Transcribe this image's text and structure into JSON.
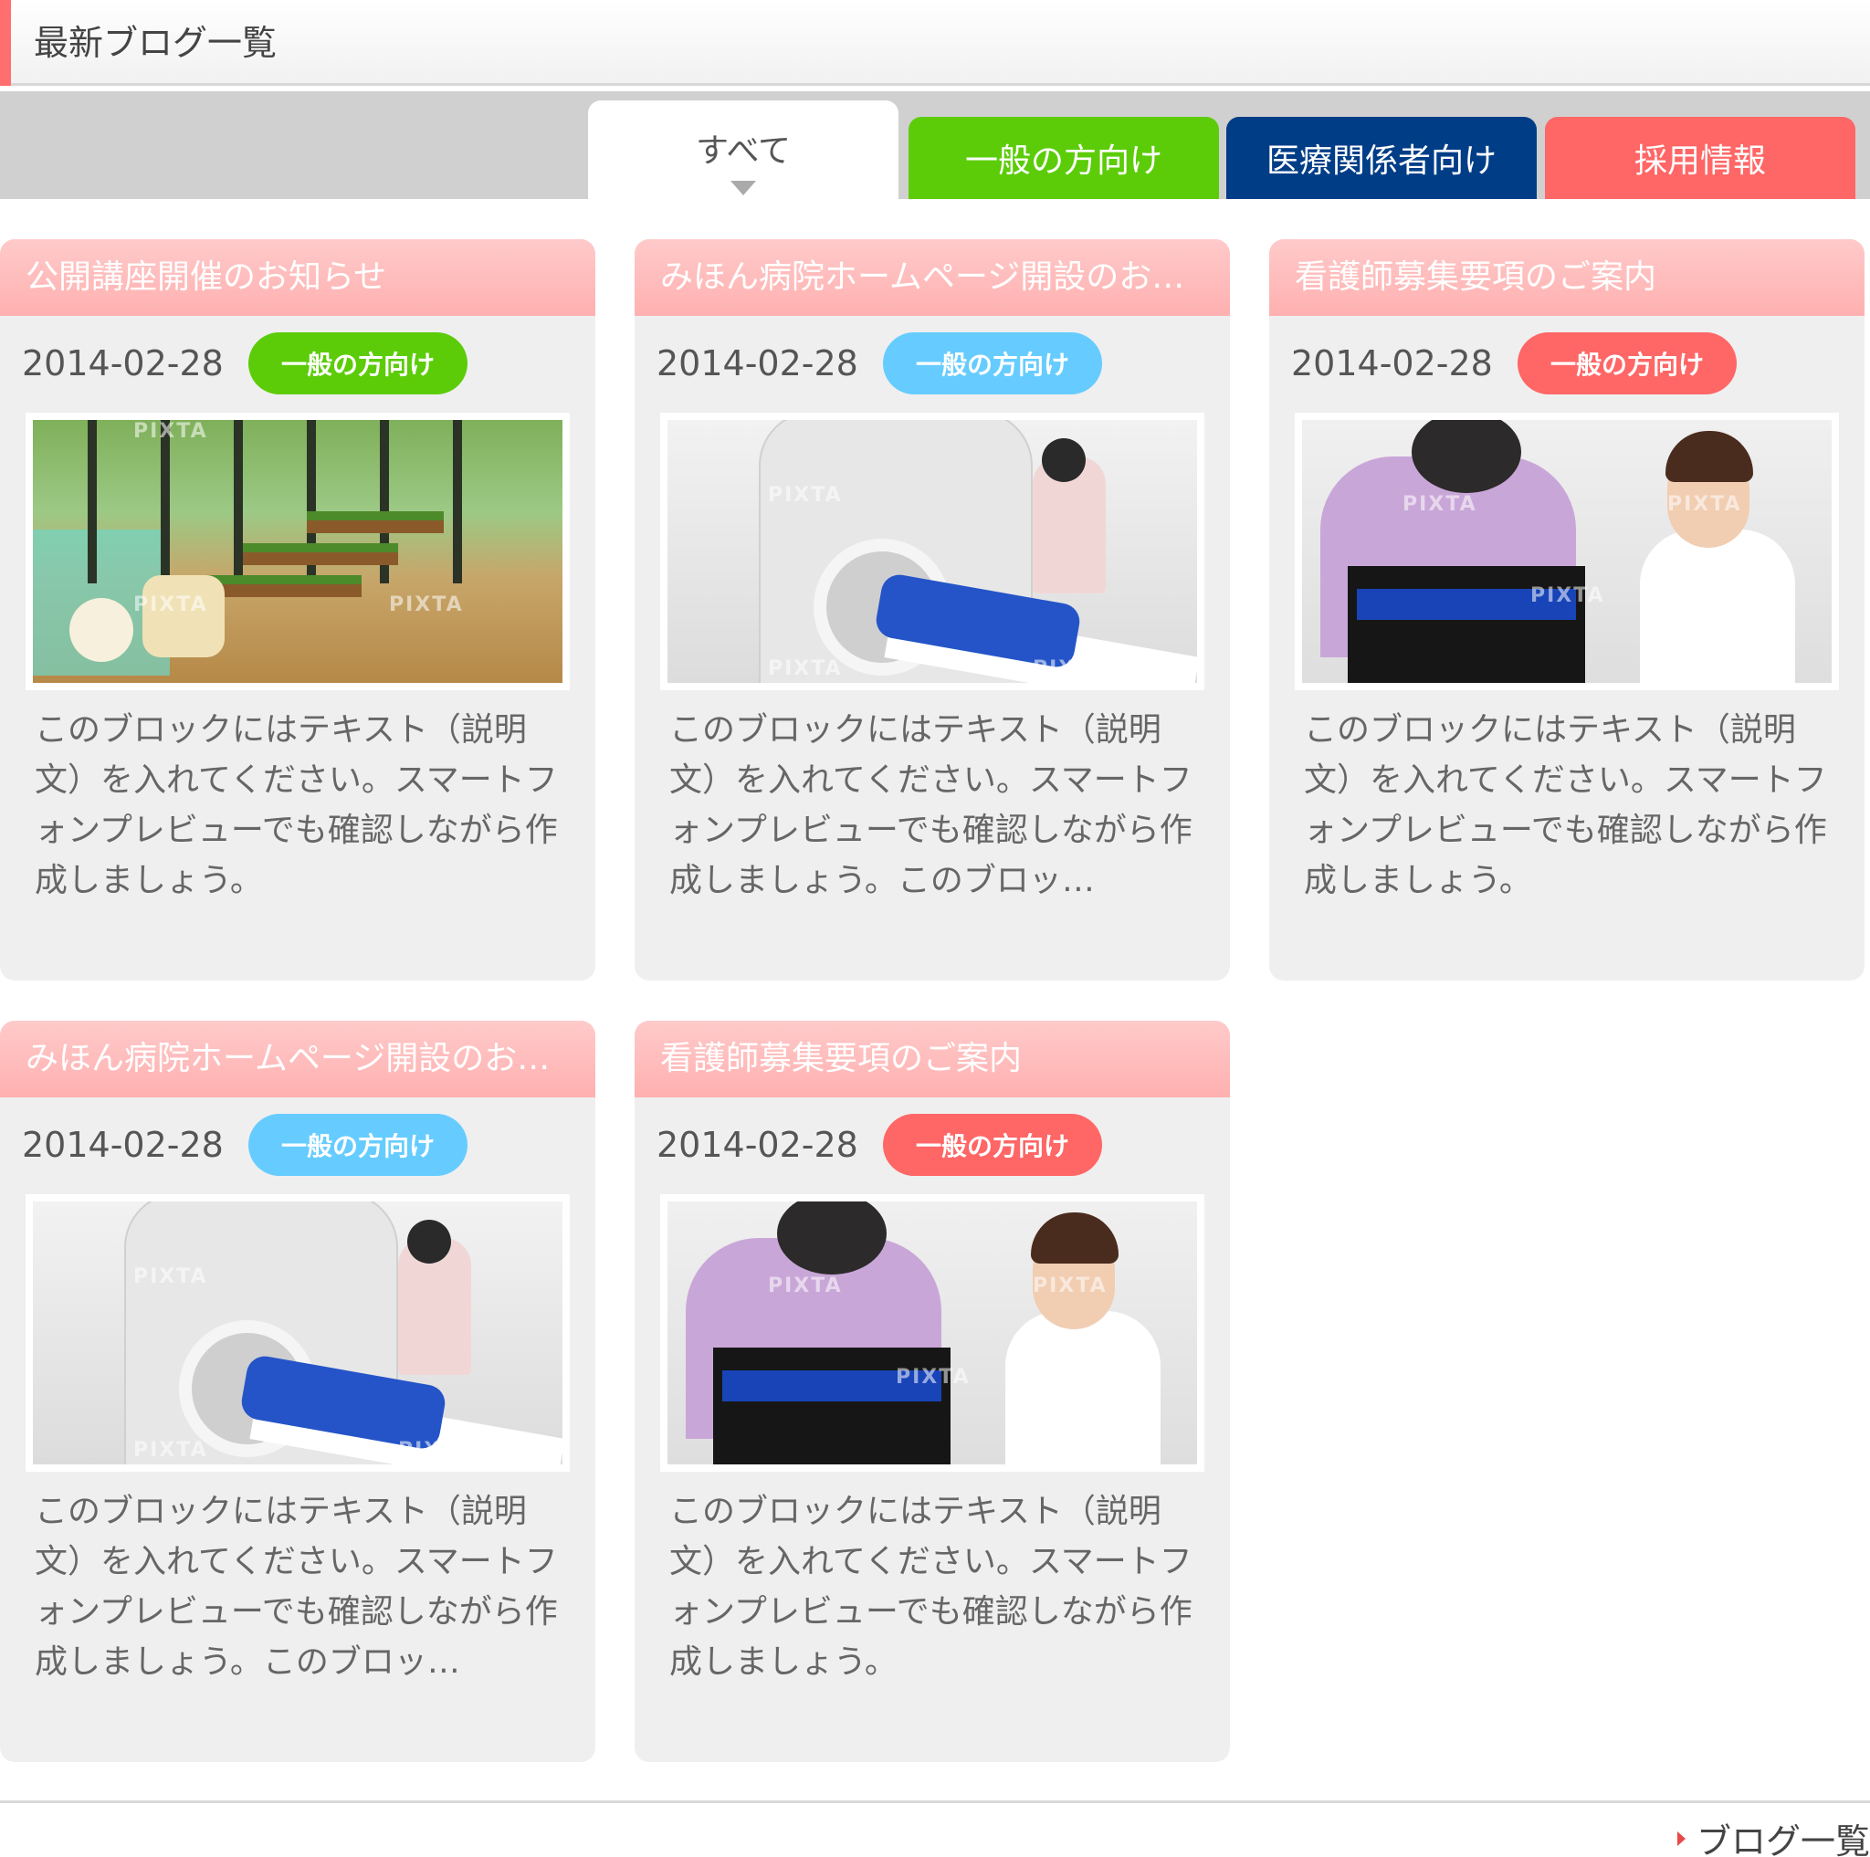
{
  "header": {
    "title": "最新ブログ一覧"
  },
  "tabs": [
    {
      "label": "すべて",
      "active": true
    },
    {
      "label": "一般の方向け",
      "color": "#5ccc09"
    },
    {
      "label": "医療関係者向け",
      "color": "#003d87"
    },
    {
      "label": "採用情報",
      "color": "#ff6666"
    }
  ],
  "posts": [
    {
      "title": "公開講座開催のお知らせ",
      "date": "2014-02-28",
      "category": "一般の方向け",
      "badge_color": "#5ccc09",
      "photo": "sunroom-photo",
      "excerpt": "このブロックにはテキスト（説明文）を入れてください。スマートフォンプレビューでも確認しながら作成しましょう。"
    },
    {
      "title": "みほん病院ホームページ開設のお…",
      "date": "2014-02-28",
      "category": "一般の方向け",
      "badge_color": "#66ccff",
      "photo": "ct-scan-photo",
      "excerpt": "このブロックにはテキスト（説明文）を入れてください。スマートフォンプレビューでも確認しながら作成しましょう。このブロッ…"
    },
    {
      "title": "看護師募集要項のご案内",
      "date": "2014-02-28",
      "category": "一般の方向け",
      "badge_color": "#ff6666",
      "photo": "nurse-wheelchair-photo",
      "excerpt": "このブロックにはテキスト（説明文）を入れてください。スマートフォンプレビューでも確認しながら作成しましょう。"
    },
    {
      "title": "みほん病院ホームページ開設のお…",
      "date": "2014-02-28",
      "category": "一般の方向け",
      "badge_color": "#66ccff",
      "photo": "ct-scan-photo",
      "excerpt": "このブロックにはテキスト（説明文）を入れてください。スマートフォンプレビューでも確認しながら作成しましょう。このブロッ…"
    },
    {
      "title": "看護師募集要項のご案内",
      "date": "2014-02-28",
      "category": "一般の方向け",
      "badge_color": "#ff6666",
      "photo": "nurse-wheelchair-photo",
      "excerpt": "このブロックにはテキスト（説明文）を入れてください。スマートフォンプレビューでも確認しながら作成しましょう。"
    }
  ],
  "photo_watermark": "PIXTA",
  "footer": {
    "link_label": "ブログ一覧"
  }
}
